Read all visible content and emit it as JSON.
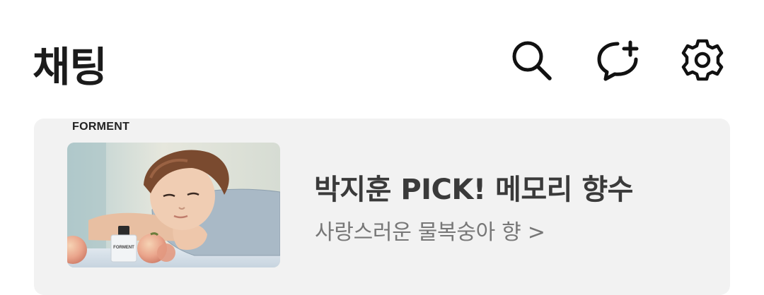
{
  "header": {
    "title": "채팅",
    "icons": [
      "search-icon",
      "new-chat-icon",
      "settings-icon"
    ]
  },
  "ad": {
    "brand": "FORMENT",
    "bottle_label": "FORMENT",
    "headline": "박지훈 PICK! 메모리 향수",
    "subtitle": "사랑스러운 물복숭아 향 >"
  },
  "colors": {
    "background": "#ffffff",
    "banner_bg": "#f2f2f2",
    "title": "#1b1b1b",
    "headline": "#3a3a3a",
    "subtitle": "#777777"
  }
}
